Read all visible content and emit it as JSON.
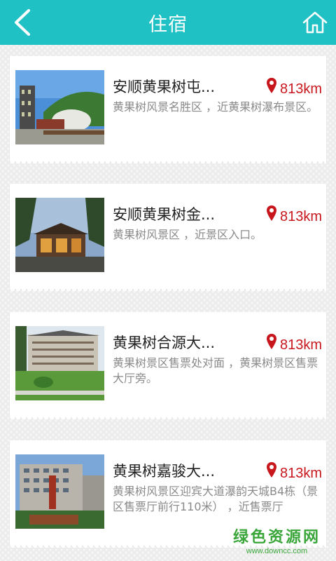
{
  "header": {
    "title": "住宿",
    "back_icon": "chevron-left-icon",
    "home_icon": "home-icon",
    "bg_color": "#1fc1c5"
  },
  "hotels": [
    {
      "name": "安顺黄果树屯...",
      "distance": "813km",
      "address": "黄果树风景名胜区 ，近黄果树瀑布景区。"
    },
    {
      "name": "安顺黄果树金...",
      "distance": "813km",
      "address": "黄果树风景区 ，近景区入口。"
    },
    {
      "name": "黄果树合源大...",
      "distance": "813km",
      "address": "黄果树景区售票处对面 ，黄果树景区售票大厅旁。"
    },
    {
      "name": "黄果树嘉骏大...",
      "distance": "813km",
      "address": "黄果树风景区迎宾大道瀑韵天城B4栋（景区售票厅前行110米） ，近售票厅"
    }
  ],
  "location_icon": "map-pin-icon",
  "accent_color": "#c8161d",
  "watermark": {
    "main": "绿色资源网",
    "sub": "www.downcc.com"
  }
}
